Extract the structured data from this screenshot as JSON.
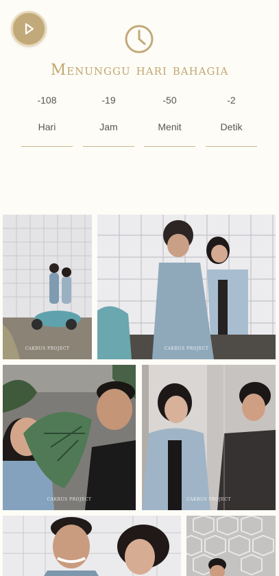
{
  "music": {
    "icon": "play-icon"
  },
  "header": {
    "icon": "clock-icon",
    "title": "Menunggu hari bahagia"
  },
  "countdown": [
    {
      "value": "-108",
      "label": "Hari"
    },
    {
      "value": "-19",
      "label": "Jam"
    },
    {
      "value": "-50",
      "label": "Menit"
    },
    {
      "value": "-2",
      "label": "Detik"
    }
  ],
  "gallery": {
    "watermark": "CAKRUS PROJECT",
    "photos": [
      {
        "description": "Couple on blue scooter in front of tiled wall"
      },
      {
        "description": "Couple with scooter laughing near white tiled wall"
      },
      {
        "description": "Couple laughing holding a monstera leaf"
      },
      {
        "description": "Woman in denim jacket beside window"
      },
      {
        "description": "Couple smiling in front of tiled wall"
      },
      {
        "description": "Man in front of hexagon patterned wall"
      }
    ]
  },
  "colors": {
    "accent": "#c2a97a",
    "background": "#fdfcf6"
  }
}
